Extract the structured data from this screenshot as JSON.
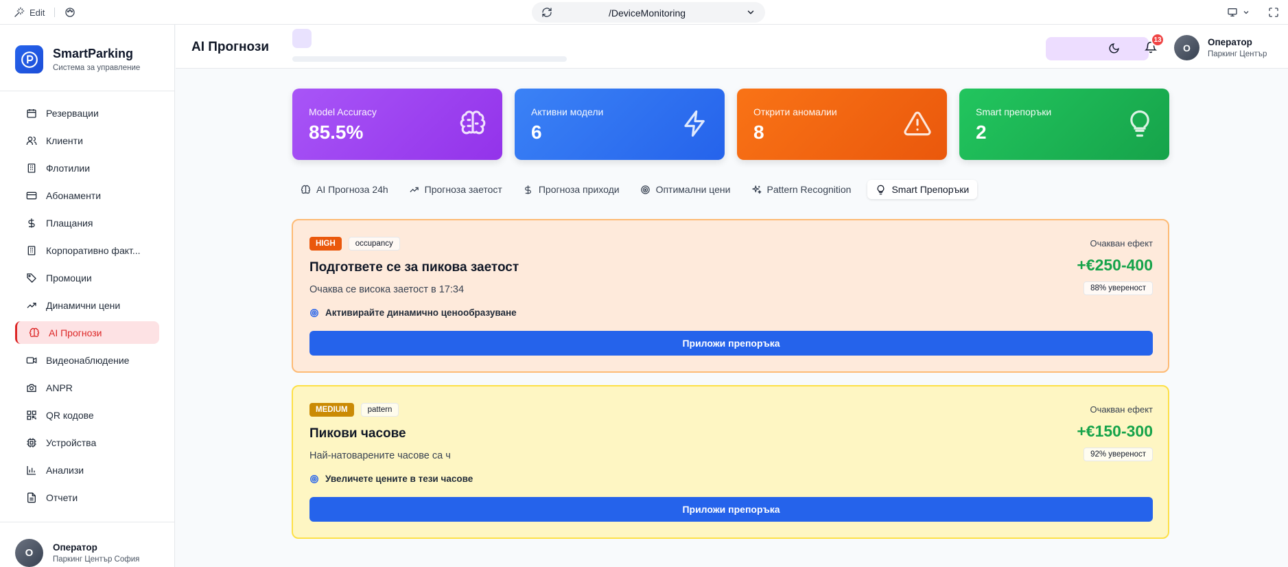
{
  "topbar": {
    "edit_label": "Edit",
    "url": "/DeviceMonitoring"
  },
  "sidebar": {
    "brand_title": "SmartParking",
    "brand_subtitle": "Система за управление",
    "items": [
      {
        "label": "Резервации",
        "icon": "calendar-icon"
      },
      {
        "label": "Клиенти",
        "icon": "users-icon"
      },
      {
        "label": "Флотилии",
        "icon": "building-icon"
      },
      {
        "label": "Абонаменти",
        "icon": "credit-card-icon"
      },
      {
        "label": "Плащания",
        "icon": "dollar-icon"
      },
      {
        "label": "Корпоративно факт...",
        "icon": "building-icon"
      },
      {
        "label": "Промоции",
        "icon": "tag-icon"
      },
      {
        "label": "Динамични цени",
        "icon": "trending-up-icon"
      },
      {
        "label": "AI Прогнози",
        "icon": "brain-icon",
        "active": true
      },
      {
        "label": "Видеонаблюдение",
        "icon": "video-icon"
      },
      {
        "label": "ANPR",
        "icon": "camera-icon"
      },
      {
        "label": "QR кодове",
        "icon": "qr-code-icon"
      },
      {
        "label": "Устройства",
        "icon": "cpu-icon"
      },
      {
        "label": "Анализи",
        "icon": "bar-chart-icon"
      },
      {
        "label": "Отчети",
        "icon": "file-icon"
      }
    ],
    "user": {
      "initial": "О",
      "name": "Оператор",
      "subtitle": "Паркинг Център София"
    }
  },
  "header": {
    "title": "AI Прогнози",
    "notifications_count": "13",
    "user": {
      "initial": "О",
      "name": "Оператор",
      "subtitle": "Паркинг Център"
    }
  },
  "stats": [
    {
      "label": "Model Accuracy",
      "value": "85.5%",
      "icon": "brain-icon",
      "color_from": "#a855f7",
      "color_to": "#9333ea"
    },
    {
      "label": "Активни модели",
      "value": "6",
      "icon": "zap-icon",
      "color_from": "#3b82f6",
      "color_to": "#2563eb"
    },
    {
      "label": "Открити аномалии",
      "value": "8",
      "icon": "alert-triangle-icon",
      "color_from": "#f97316",
      "color_to": "#ea580c"
    },
    {
      "label": "Smart препоръки",
      "value": "2",
      "icon": "lightbulb-icon",
      "color_from": "#22c55e",
      "color_to": "#16a34a"
    }
  ],
  "tabs": [
    {
      "label": "AI Прогноза 24h",
      "icon": "brain-icon"
    },
    {
      "label": "Прогноза заетост",
      "icon": "trending-up-icon"
    },
    {
      "label": "Прогноза приходи",
      "icon": "dollar-icon"
    },
    {
      "label": "Оптимални цени",
      "icon": "target-icon"
    },
    {
      "label": "Pattern Recognition",
      "icon": "sparkles-icon"
    },
    {
      "label": "Smart Препоръки",
      "icon": "lightbulb-icon",
      "active": true
    }
  ],
  "recommendations": [
    {
      "priority": "HIGH",
      "category": "occupancy",
      "title": "Подгответе се за пикова заетост",
      "description": "Очаква се висока заетост в 17:34",
      "action": "Активирайте динамично ценообразуване",
      "effect_label": "Очакван ефект",
      "effect_value": "+€250-400",
      "confidence": "88% увереност",
      "button": "Приложи препоръка",
      "bg": "#feeadb",
      "border": "#fdba74",
      "badge_color": "#ea580c"
    },
    {
      "priority": "MEDIUM",
      "category": "pattern",
      "title": "Пикови часове",
      "description": "Най-натоварените часове са ч",
      "action": "Увеличете цените в тези часове",
      "effect_label": "Очакван ефект",
      "effect_value": "+€150-300",
      "confidence": "92% увереност",
      "button": "Приложи препоръка",
      "bg": "#fef6c3",
      "border": "#fde047",
      "badge_color": "#ca8a04"
    }
  ]
}
